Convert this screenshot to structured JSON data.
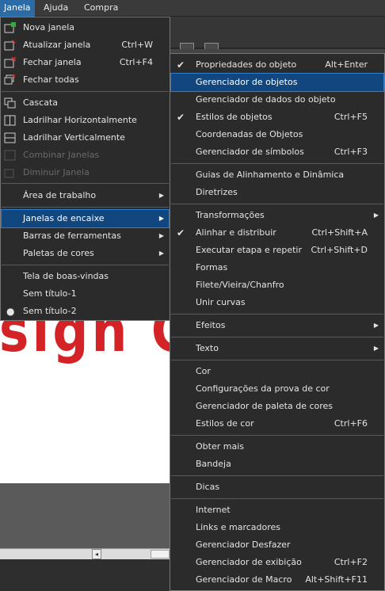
{
  "menubar": {
    "items": [
      "Janela",
      "Ajuda",
      "Compra"
    ]
  },
  "canvas": {
    "text": "esign C"
  },
  "menu_janela": {
    "items": [
      {
        "label": "Nova janela"
      },
      {
        "label": "Atualizar janela",
        "shortcut": "Ctrl+W"
      },
      {
        "label": "Fechar janela",
        "shortcut": "Ctrl+F4"
      },
      {
        "label": "Fechar todas"
      },
      {
        "label": "Cascata"
      },
      {
        "label": "Ladrilhar Horizontalmente"
      },
      {
        "label": "Ladrilhar Verticalmente"
      },
      {
        "label": "Combinar Janelas"
      },
      {
        "label": "Diminuir Janela"
      },
      {
        "label": "Área de trabalho"
      },
      {
        "label": "Janelas de encaixe"
      },
      {
        "label": "Barras de ferramentas"
      },
      {
        "label": "Paletas de cores"
      },
      {
        "label": "Tela de boas-vindas"
      },
      {
        "label": "Sem título-1"
      },
      {
        "label": "Sem título-2"
      }
    ]
  },
  "menu_encaixe": {
    "items": [
      {
        "label": "Propriedades do objeto",
        "shortcut": "Alt+Enter"
      },
      {
        "label": "Gerenciador de objetos"
      },
      {
        "label": "Gerenciador de dados do objeto"
      },
      {
        "label": "Estilos de objetos",
        "shortcut": "Ctrl+F5"
      },
      {
        "label": "Coordenadas de Objetos"
      },
      {
        "label": "Gerenciador de símbolos",
        "shortcut": "Ctrl+F3"
      },
      {
        "label": "Guias de Alinhamento e Dinâmica"
      },
      {
        "label": "Diretrizes"
      },
      {
        "label": "Transformações"
      },
      {
        "label": "Alinhar e distribuir",
        "shortcut": "Ctrl+Shift+A"
      },
      {
        "label": "Executar etapa e repetir",
        "shortcut": "Ctrl+Shift+D"
      },
      {
        "label": "Formas"
      },
      {
        "label": "Filete/Vieira/Chanfro"
      },
      {
        "label": "Unir curvas"
      },
      {
        "label": "Efeitos"
      },
      {
        "label": "Texto"
      },
      {
        "label": "Cor"
      },
      {
        "label": "Configurações da prova de cor"
      },
      {
        "label": "Gerenciador de paleta de cores"
      },
      {
        "label": "Estilos de cor",
        "shortcut": "Ctrl+F6"
      },
      {
        "label": "Obter mais"
      },
      {
        "label": "Bandeja"
      },
      {
        "label": "Dicas"
      },
      {
        "label": "Internet"
      },
      {
        "label": "Links e marcadores"
      },
      {
        "label": "Gerenciador Desfazer"
      },
      {
        "label": "Gerenciador de exibição",
        "shortcut": "Ctrl+F2"
      },
      {
        "label": "Gerenciador de Macro",
        "shortcut": "Alt+Shift+F11"
      }
    ]
  },
  "colors": {
    "highlight": "#11467e",
    "accent": "#2b6ca7",
    "brand_text": "#d32326"
  }
}
